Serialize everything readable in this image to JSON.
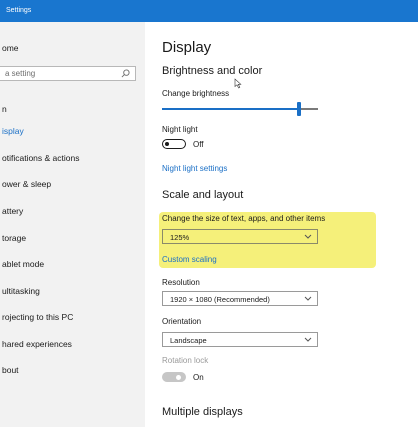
{
  "window": {
    "title": "Settings"
  },
  "sidebar": {
    "home": "ome",
    "search_placeholder": "a setting",
    "group_label": "n",
    "items": [
      "isplay",
      "otifications & actions",
      "ower & sleep",
      "attery",
      "torage",
      "ablet mode",
      "ultitasking",
      "rojecting to this PC",
      "hared experiences",
      "bout"
    ]
  },
  "main": {
    "page_title": "Display",
    "brightness": {
      "heading": "Brightness and color",
      "change_label": "Change brightness",
      "level_percent": 88,
      "night_light_label": "Night light",
      "night_light_state": "Off",
      "night_light_settings_link": "Night light settings"
    },
    "scale": {
      "heading": "Scale and layout",
      "size_label": "Change the size of text, apps, and other items",
      "size_value": "125%",
      "custom_scaling_link": "Custom scaling",
      "resolution_label": "Resolution",
      "resolution_value": "1920 × 1080 (Recommended)",
      "orientation_label": "Orientation",
      "orientation_value": "Landscape",
      "rotation_lock_label": "Rotation lock",
      "rotation_lock_state": "On"
    },
    "multiple_displays_heading": "Multiple displays"
  },
  "colors": {
    "accent": "#1a6fc6",
    "titlebar": "#1976cf",
    "highlight": "#f5f07a"
  }
}
